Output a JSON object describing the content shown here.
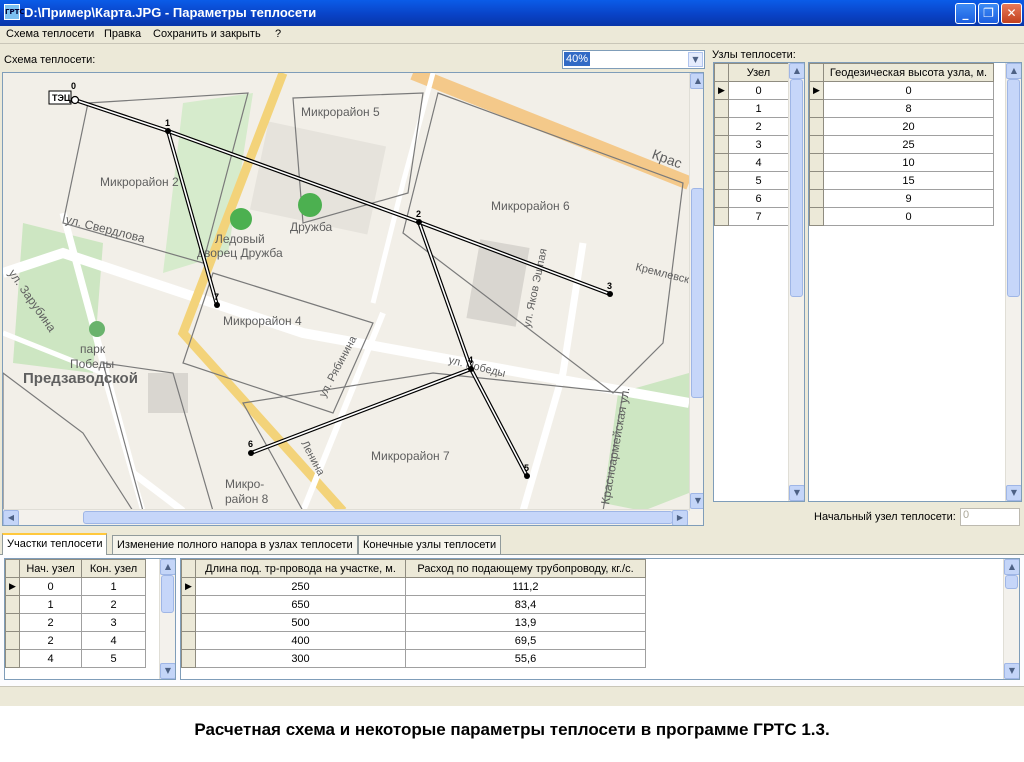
{
  "window": {
    "title": "D:\\Пример\\Карта.JPG - Параметры теплосети",
    "icon": "ГРТС",
    "controls": [
      "minimize-icon",
      "maximize-icon",
      "close-icon"
    ]
  },
  "menu": [
    "Схема теплосети",
    "Правка",
    "Сохранить и закрыть",
    "?"
  ],
  "scheme": {
    "label": "Схема теплосети:",
    "zoom": "40%",
    "source_label": "ТЭЦ",
    "map_labels": [
      "Микрорайон 5",
      "Микрорайон 2",
      "Микрорайон 6",
      "Ледовый",
      "дворец Дружба",
      "Дружба",
      "ул. Свердлова",
      "ул. Зарубина",
      "парк",
      "Победы",
      "Предзаводской",
      "Микрорайон 4",
      "ул. Рябинина",
      "ул. Победы",
      "Микрорайон 7",
      "Микро-",
      "район 8",
      "ул. Яков Эшпая",
      "Кремлевская",
      "Красноармейская ул.",
      "Ленина",
      "Крас"
    ],
    "nodes": [
      "0",
      "1",
      "2",
      "3",
      "4",
      "5",
      "6",
      "7"
    ]
  },
  "nodes_panel": {
    "label": "Узлы теплосети:",
    "col_node": "Узел",
    "col_height": "Геодезическая высота узла, м.",
    "rows": [
      {
        "node": "0",
        "height": "0"
      },
      {
        "node": "1",
        "height": "8"
      },
      {
        "node": "2",
        "height": "20"
      },
      {
        "node": "3",
        "height": "25"
      },
      {
        "node": "4",
        "height": "10"
      },
      {
        "node": "5",
        "height": "15"
      },
      {
        "node": "6",
        "height": "9"
      },
      {
        "node": "7",
        "height": "0"
      }
    ],
    "start_label": "Начальный узел теплосети:",
    "start_value": "0"
  },
  "tabs": [
    "Участки теплосети",
    "Изменение полного напора в узлах теплосети",
    "Конечные узлы теплосети"
  ],
  "segments": {
    "col_start": "Нач. узел",
    "col_end": "Кон. узел",
    "col_length": "Длина под. тр-провода на участке, м.",
    "col_flow": "Расход по подающему трубопроводу, кг./с.",
    "rows": [
      {
        "start": "0",
        "end": "1",
        "length": "250",
        "flow": "111,2"
      },
      {
        "start": "1",
        "end": "2",
        "length": "650",
        "flow": "83,4"
      },
      {
        "start": "2",
        "end": "3",
        "length": "500",
        "flow": "13,9"
      },
      {
        "start": "2",
        "end": "4",
        "length": "400",
        "flow": "69,5"
      },
      {
        "start": "4",
        "end": "5",
        "length": "300",
        "flow": "55,6"
      }
    ]
  },
  "caption": "Расчетная схема и некоторые параметры теплосети в программе ГРТС 1.3."
}
